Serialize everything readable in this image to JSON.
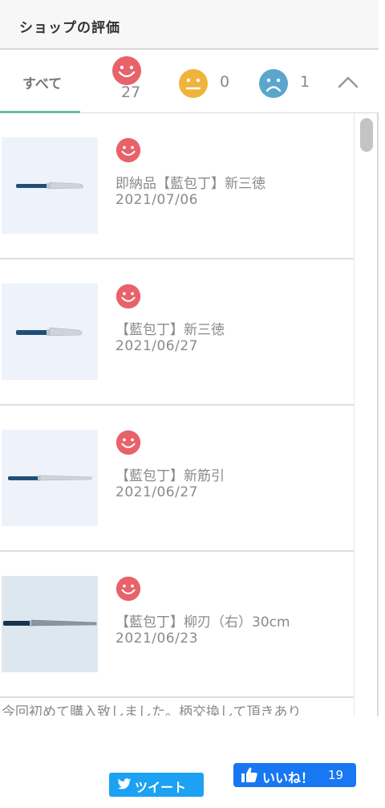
{
  "header": {
    "title": "ショップの評価"
  },
  "tabs": {
    "all_label": "すべて",
    "good": {
      "count": "27",
      "icon": "smile-face-icon",
      "color": "#e8626a"
    },
    "neutral": {
      "count": "0",
      "icon": "neutral-face-icon",
      "color": "#f0b43c"
    },
    "bad": {
      "count": "1",
      "icon": "sad-face-icon",
      "color": "#5ba6cc"
    },
    "collapse_icon": "chevron-up-icon"
  },
  "reviews": [
    {
      "rating": "good",
      "product": "即納品【藍包丁】新三徳",
      "date": "2021/07/06"
    },
    {
      "rating": "good",
      "product": "【藍包丁】新三徳",
      "date": "2021/06/27"
    },
    {
      "rating": "good",
      "product": "【藍包丁】新筋引",
      "date": "2021/06/27"
    },
    {
      "rating": "good",
      "product": "【藍包丁】柳刃（右）30cm",
      "date": "2021/06/23"
    }
  ],
  "comment": "今回初めて購入致しました。柄交換して頂きあり",
  "social": {
    "tweet_label": "ツイート",
    "like_label": "いいね！",
    "like_count": "19",
    "twitter_color": "#1da1f2",
    "facebook_color": "#1877f2"
  }
}
